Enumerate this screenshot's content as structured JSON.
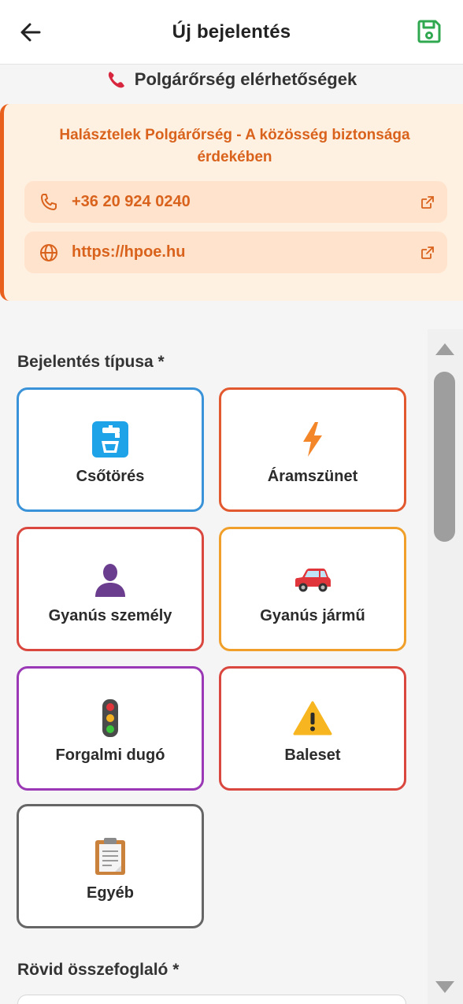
{
  "appbar": {
    "title": "Új bejelentés",
    "back_icon": "arrow-left-icon",
    "save_icon": "floppy-disk-icon",
    "save_color": "#2fa84f"
  },
  "contacts": {
    "heading": "Polgárőrség elérhetőségek",
    "heading_icon": "telephone-receiver-icon",
    "org_name": "Halásztelek Polgárőrség - A közösség biztonsága érdekében",
    "phone": "+36 20 924 0240",
    "website": "https://hpoe.hu",
    "accent": "#e8601c",
    "background": "#fff1e2"
  },
  "report_types": {
    "label": "Bejelentés típusa *",
    "items": [
      {
        "label": "Csőtörés",
        "icon": "water-tap-icon",
        "color": "#3a93d8"
      },
      {
        "label": "Áramszünet",
        "icon": "lightning-icon",
        "color": "#e2592f"
      },
      {
        "label": "Gyanús személy",
        "icon": "person-silhouette-icon",
        "color": "#d9473f"
      },
      {
        "label": "Gyanús jármű",
        "icon": "car-icon",
        "color": "#f0a02a"
      },
      {
        "label": "Forgalmi dugó",
        "icon": "traffic-light-icon",
        "color": "#9b38b5"
      },
      {
        "label": "Baleset",
        "icon": "warning-icon",
        "color": "#d9473f"
      },
      {
        "label": "Egyéb",
        "icon": "clipboard-icon",
        "color": "#666666"
      }
    ]
  },
  "summary": {
    "label": "Rövid összefoglaló *"
  }
}
